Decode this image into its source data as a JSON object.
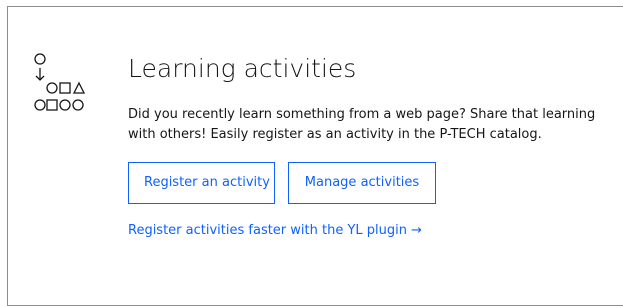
{
  "card": {
    "icon": "activity-flow-pictogram",
    "title": "Learning activities",
    "description": "Did you recently learn something from a web page? Share that learning with others! Easily register as an activity in the P-TECH catalog.",
    "buttons": {
      "register_label": "Register an activity",
      "manage_label": "Manage activities"
    },
    "plugin_link": {
      "label": "Register activities faster with the YL plugin",
      "arrow": "→"
    }
  },
  "colors": {
    "accent": "#0f62fe",
    "text": "#161616",
    "border": "#8d8d8d"
  }
}
